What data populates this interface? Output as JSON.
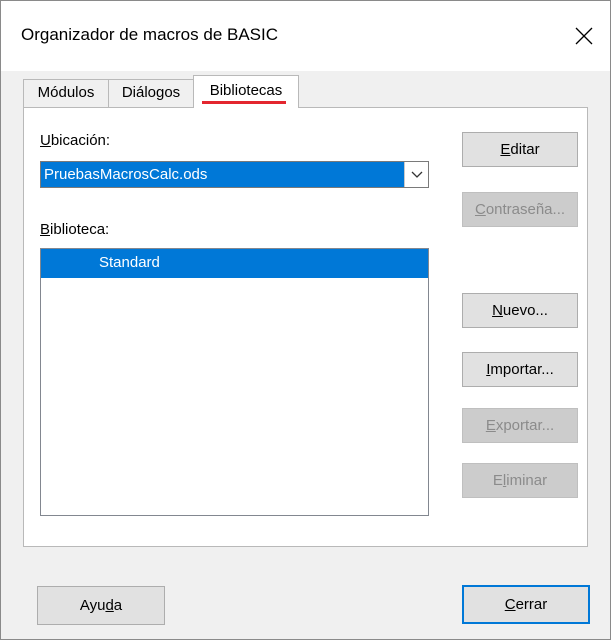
{
  "window": {
    "title": "Organizador de macros de BASIC"
  },
  "tabs": [
    {
      "label": "Módulos",
      "active": false
    },
    {
      "label": "Diálogos",
      "active": false
    },
    {
      "label": "Bibliotecas",
      "active": true
    }
  ],
  "location": {
    "label_first": "U",
    "label_rest": "bicación:",
    "selected": "PruebasMacrosCalc.ods"
  },
  "library": {
    "label_first": "B",
    "label_rest": "iblioteca:",
    "items": [
      "Standard"
    ]
  },
  "buttons": {
    "edit": {
      "pre": "",
      "mn": "E",
      "post": "ditar",
      "enabled": true
    },
    "password": {
      "pre": "",
      "mn": "C",
      "post": "ontraseña...",
      "enabled": false
    },
    "new": {
      "pre": "",
      "mn": "N",
      "post": "uevo...",
      "enabled": true
    },
    "import": {
      "pre": "",
      "mn": "I",
      "post": "mportar...",
      "enabled": true
    },
    "export": {
      "pre": "",
      "mn": "E",
      "post": "xportar...",
      "enabled": false
    },
    "delete": {
      "pre": "E",
      "mn": "l",
      "post": "iminar",
      "enabled": false
    },
    "help": {
      "pre": "Ayu",
      "mn": "d",
      "post": "a"
    },
    "close": {
      "pre": "",
      "mn": "C",
      "post": "errar"
    }
  },
  "colors": {
    "selection": "#0078d7",
    "active_tab_underline": "#e3262f"
  },
  "icons": {
    "close": "close-icon",
    "dropdown": "chevron-down-icon"
  }
}
